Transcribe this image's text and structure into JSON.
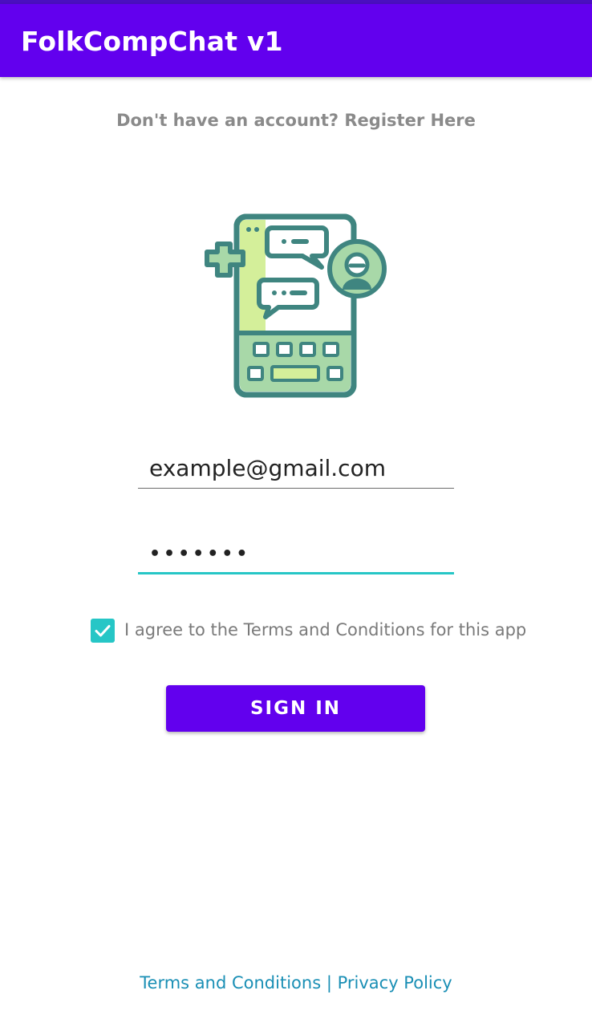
{
  "app_bar": {
    "title": "FolkCompChat v1",
    "color": "#6200ee"
  },
  "register_link": "Don't have an account? Register Here",
  "logo": {
    "icon": "chat-phone-icon"
  },
  "email_field": {
    "value": "example@gmail.com"
  },
  "password_field": {
    "value": "•••••••",
    "focused_color": "#26c6c6"
  },
  "terms_checkbox": {
    "checked": true,
    "label": "I agree to the Terms and Conditions for this app"
  },
  "sign_in_button": {
    "label": "SIGN IN"
  },
  "footer": {
    "terms_link": "Terms and Conditions",
    "separator": "|",
    "privacy_link": "Privacy Policy"
  }
}
